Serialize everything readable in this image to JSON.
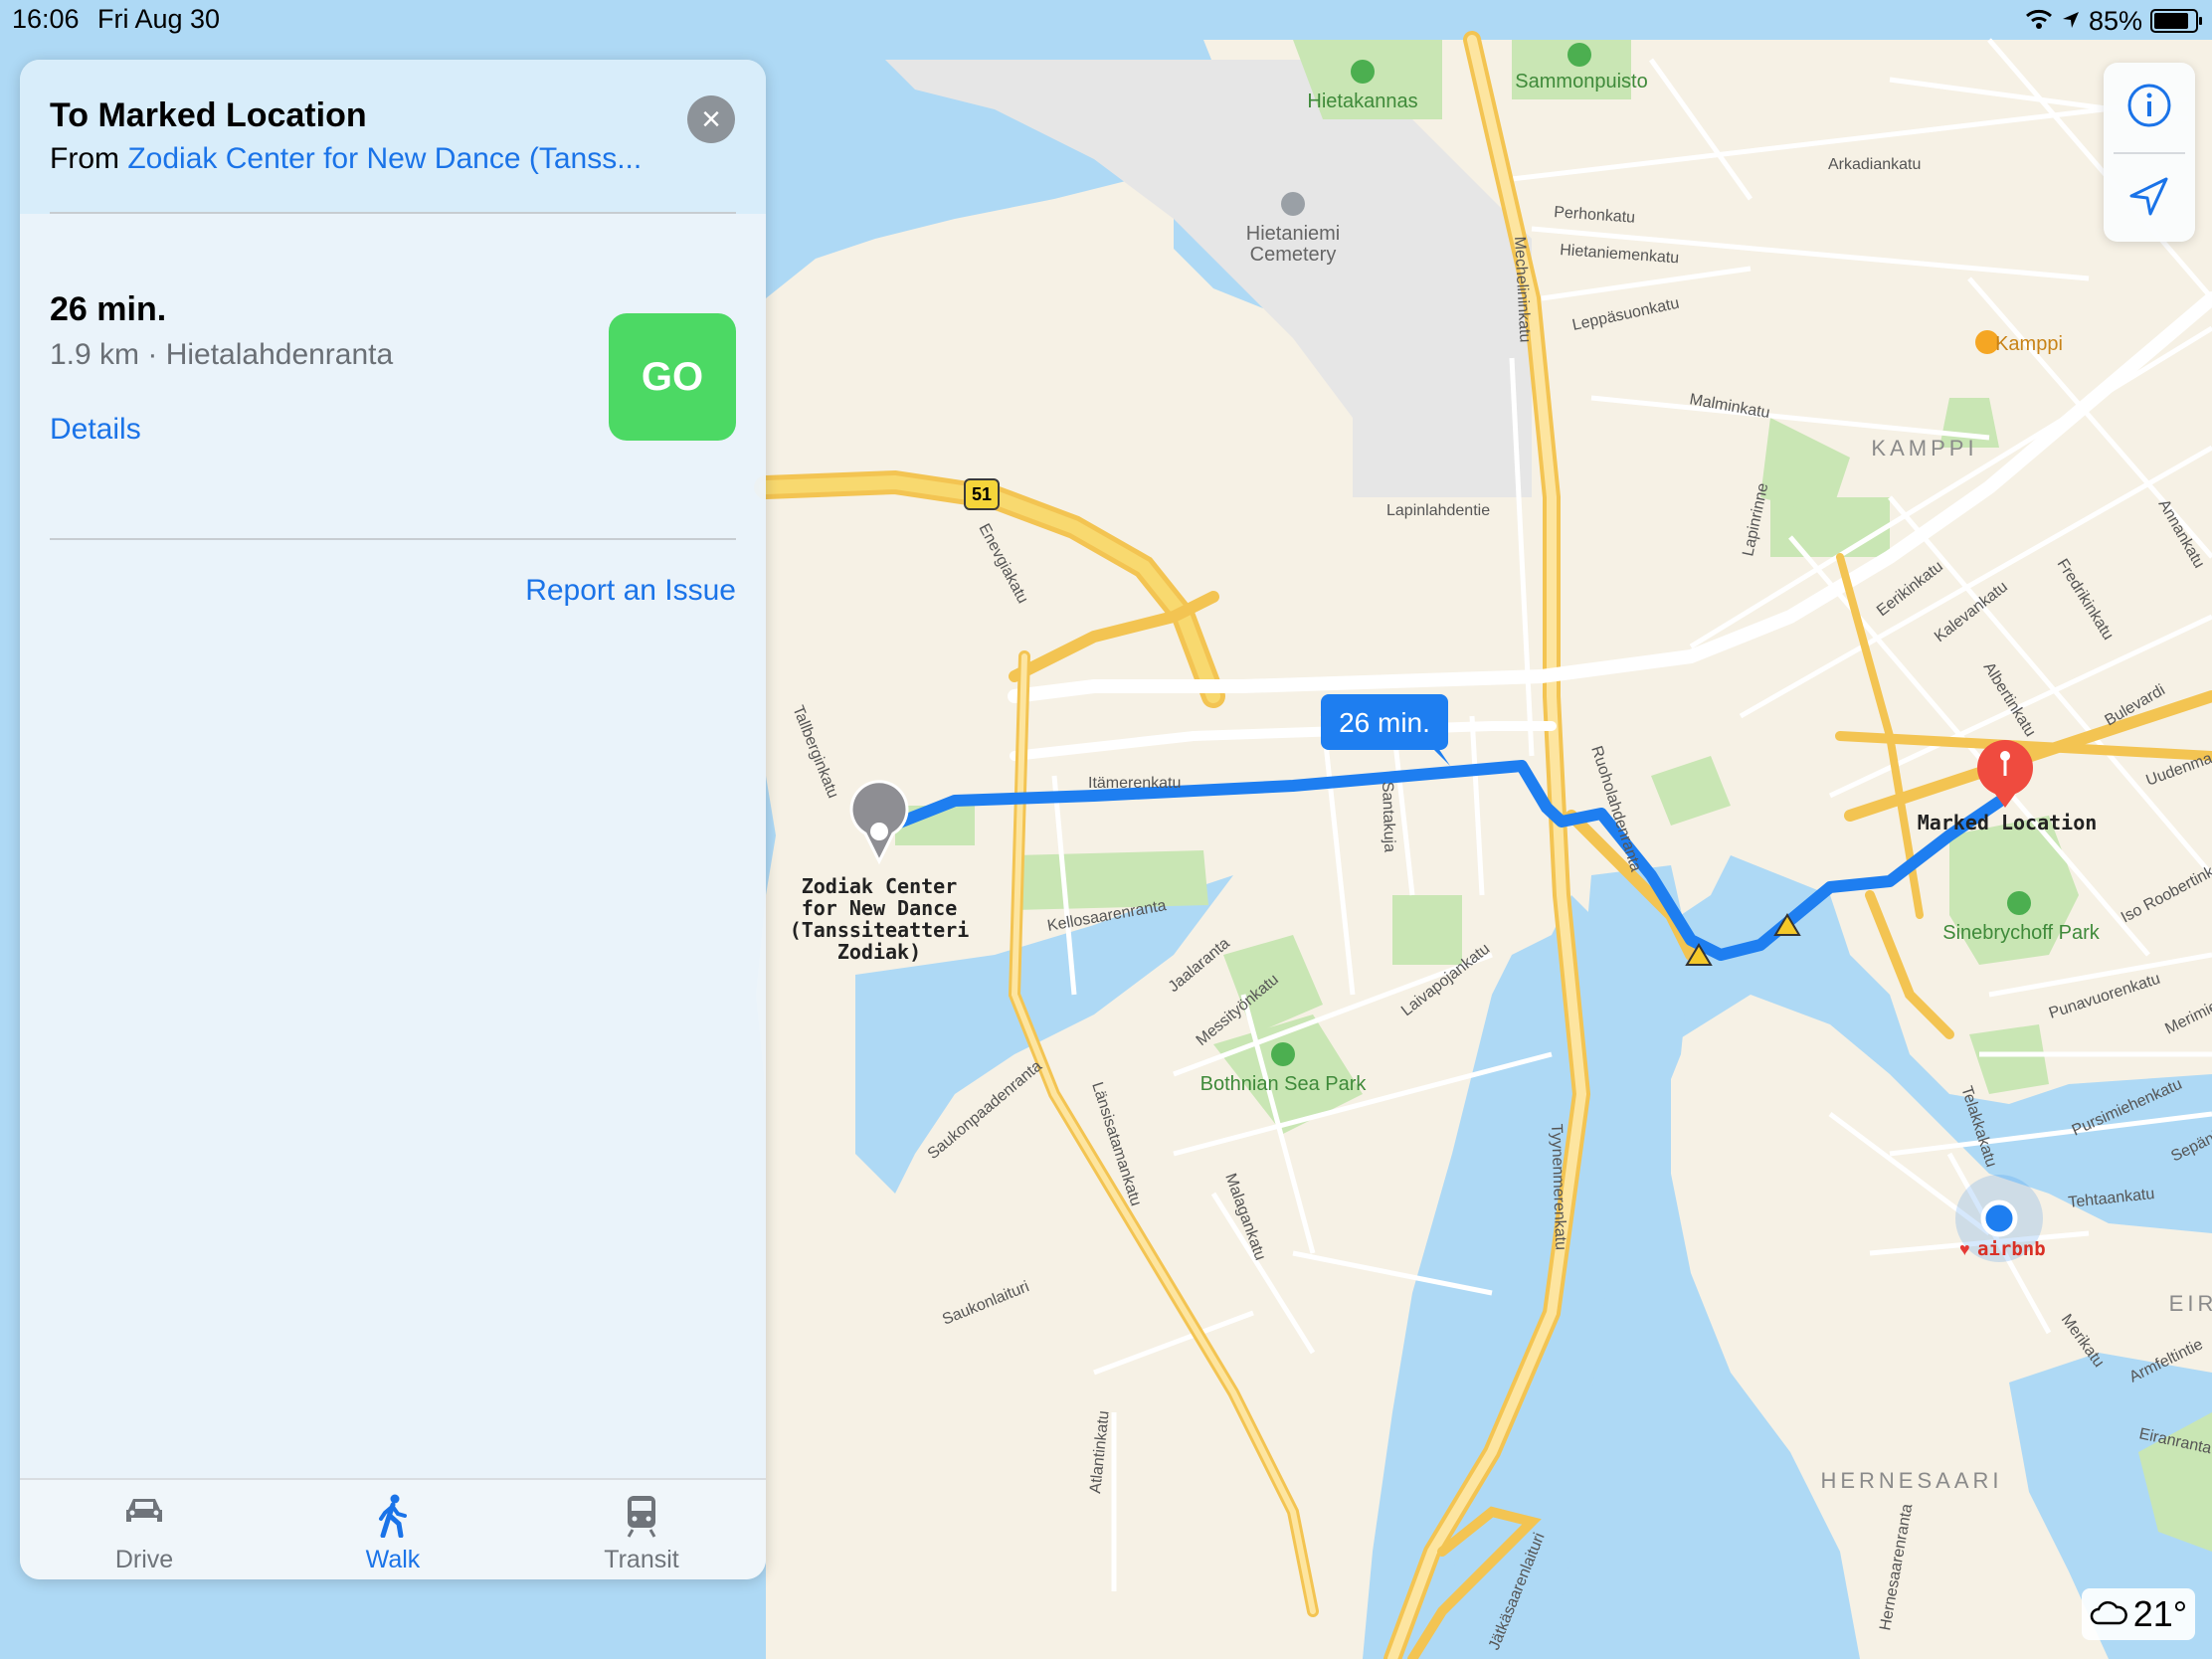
{
  "status_bar": {
    "time": "16:06",
    "date": "Fri Aug 30",
    "battery": "85%"
  },
  "panel": {
    "title": "To Marked Location",
    "from_prefix": "From",
    "from_place": "Zodiak Center for New Dance (Tanss...",
    "duration": "26 min.",
    "distance_via": "1.9 km · Hietalahdenranta",
    "details_link": "Details",
    "go_button": "GO",
    "report_link": "Report an Issue"
  },
  "tabs": [
    {
      "label": "Drive",
      "icon": "car-icon",
      "active": false
    },
    {
      "label": "Walk",
      "icon": "walk-icon",
      "active": true
    },
    {
      "label": "Transit",
      "icon": "train-icon",
      "active": false
    }
  ],
  "map": {
    "route_time_callout": "26 min.",
    "start_label": "Zodiak Center\nfor New Dance\n(Tanssiteatteri\nZodiak)",
    "end_label": "Marked Location",
    "user_location_label": "airbnb",
    "highway_shield": "51",
    "districts": [
      "KAMPPI",
      "HERNESAARI",
      "EIR"
    ],
    "places": [
      "Hietakannas",
      "Sammonpuisto",
      "Hietaniemi",
      "Cemetery",
      "Kamppi",
      "Sinebrychoff Park",
      "Bothnian Sea Park"
    ],
    "streets": [
      "Mechelininkatu",
      "Arkadiankatu",
      "Perhonkatu",
      "Hietaniemenkatu",
      "Leppäsuonkatu",
      "Malminkatu",
      "Lapinlahdentie",
      "Enevgiakatu",
      "Itämerenkatu",
      "Tallberginkatu",
      "Santakuja",
      "Kellosaarenranta",
      "Ruoholahdenranta",
      "Jaalaranta",
      "Messityönkatu",
      "Laivapojankatu",
      "Saukonpaadenranta",
      "Länsisatamankatu",
      "Malagankatu",
      "Tyynenmerenkatu",
      "Saukonlaituri",
      "Atlantinkatu",
      "Jätkäsaarenlaituri",
      "Hernesaarenranta",
      "Eerikinkatu",
      "Kalevankatu",
      "Fredrikinkatu",
      "Albertinkatu",
      "Bulevardi",
      "Annankatu",
      "Lapinrinne",
      "Iso Roobertinkatu",
      "Punavuorenkatu",
      "Pursimiehenkatu",
      "Telakkakatu",
      "Tehtaankatu",
      "Merikatu",
      "Armfeltintie",
      "Eiranranta",
      "Uudenmaankatu",
      "Merimiehenkatu",
      "Sepänkatu"
    ]
  },
  "weather": {
    "temperature": "21°",
    "icon": "cloud-icon"
  },
  "colors": {
    "accent": "#1a73e8",
    "go": "#4cd964",
    "route": "#1e7ef0",
    "end_pin": "#ef4b3f",
    "water": "#aed9f5",
    "land": "#f6f1e5",
    "park": "#c9e6b4"
  }
}
